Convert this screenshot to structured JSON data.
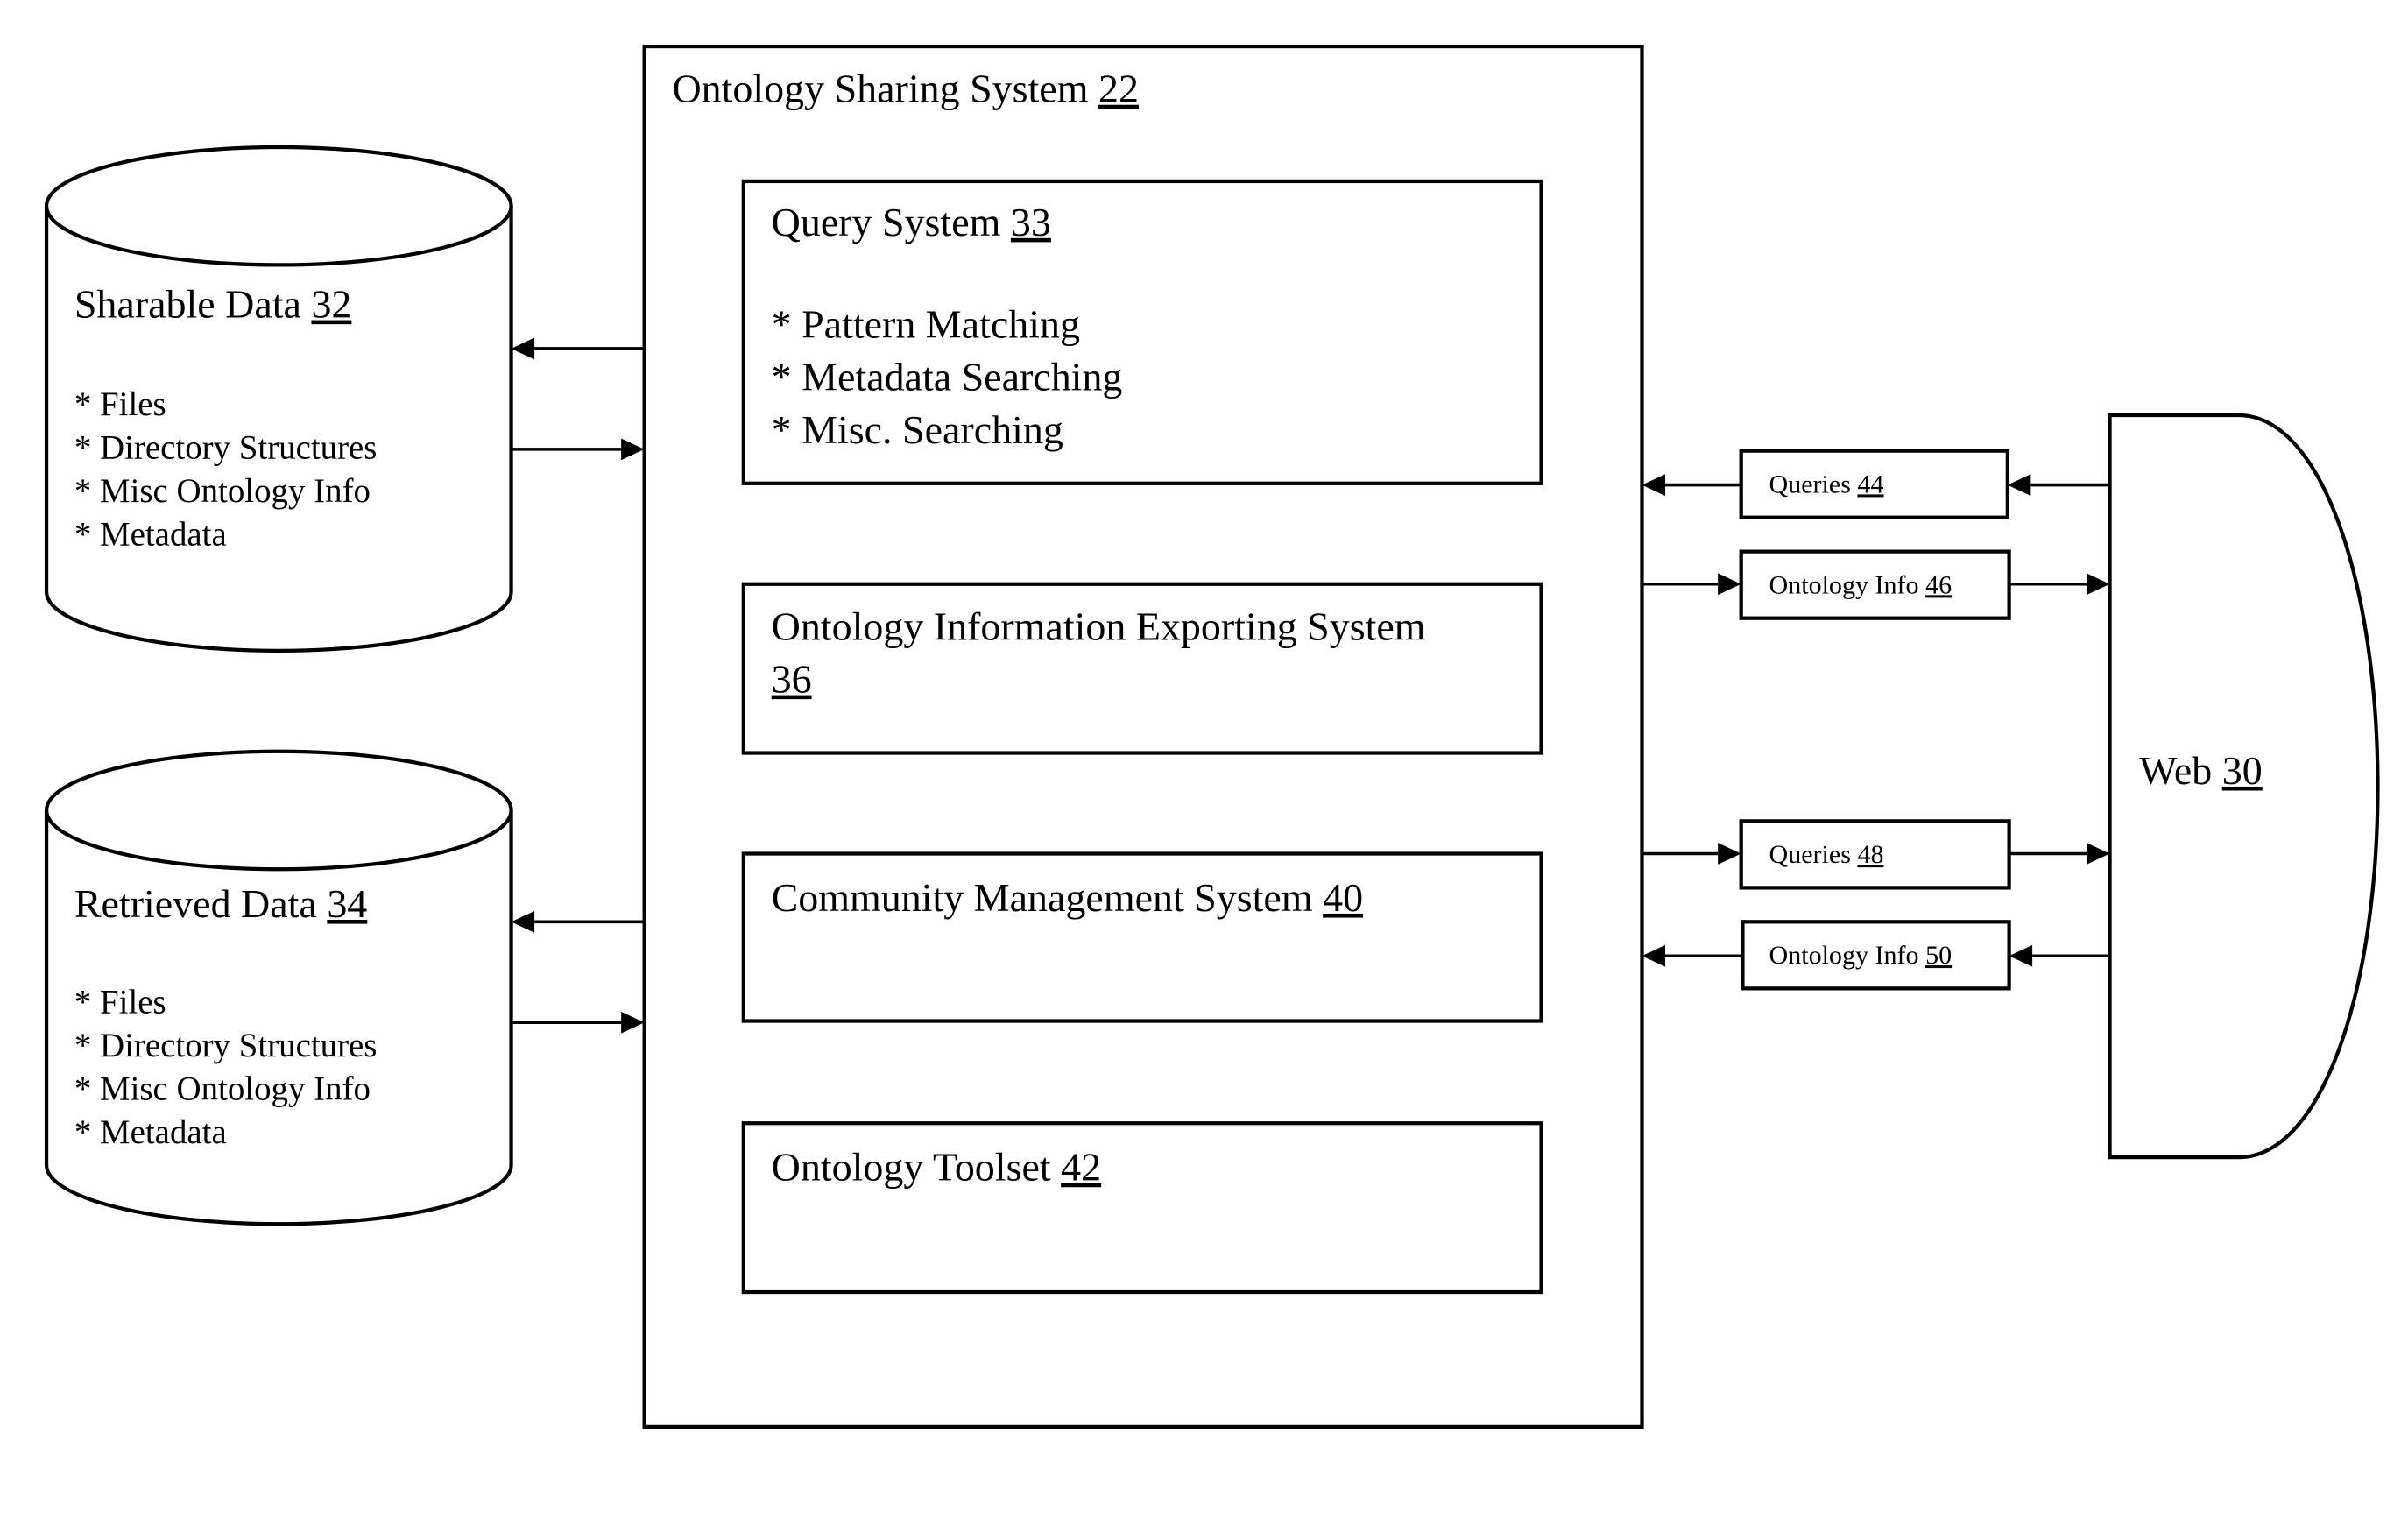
{
  "ontology_sharing_system": {
    "label": "Ontology Sharing System",
    "ref": "22"
  },
  "sharable_data": {
    "label": "Sharable Data",
    "ref": "32",
    "items": [
      "* Files",
      "* Directory Structures",
      "* Misc Ontology Info",
      "* Metadata"
    ]
  },
  "retrieved_data": {
    "label": "Retrieved Data",
    "ref": "34",
    "items": [
      "* Files",
      "* Directory Structures",
      "* Misc Ontology Info",
      "* Metadata"
    ]
  },
  "query_system": {
    "label": "Query System",
    "ref": "33",
    "items": [
      "* Pattern Matching",
      "* Metadata Searching",
      "* Misc. Searching"
    ]
  },
  "exporting_system": {
    "label": "Ontology Information Exporting System",
    "ref": "36"
  },
  "community_management": {
    "label": "Community Management System",
    "ref": "40"
  },
  "toolset": {
    "label": "Ontology Toolset",
    "ref": "42"
  },
  "web": {
    "label": "Web",
    "ref": "30"
  },
  "connectors": [
    {
      "label": "Queries",
      "ref": "44",
      "direction": "web-to-system"
    },
    {
      "label": "Ontology Info",
      "ref": "46",
      "direction": "system-to-web"
    },
    {
      "label": "Queries",
      "ref": "48",
      "direction": "system-to-web"
    },
    {
      "label": "Ontology Info",
      "ref": "50",
      "direction": "web-to-system"
    }
  ]
}
